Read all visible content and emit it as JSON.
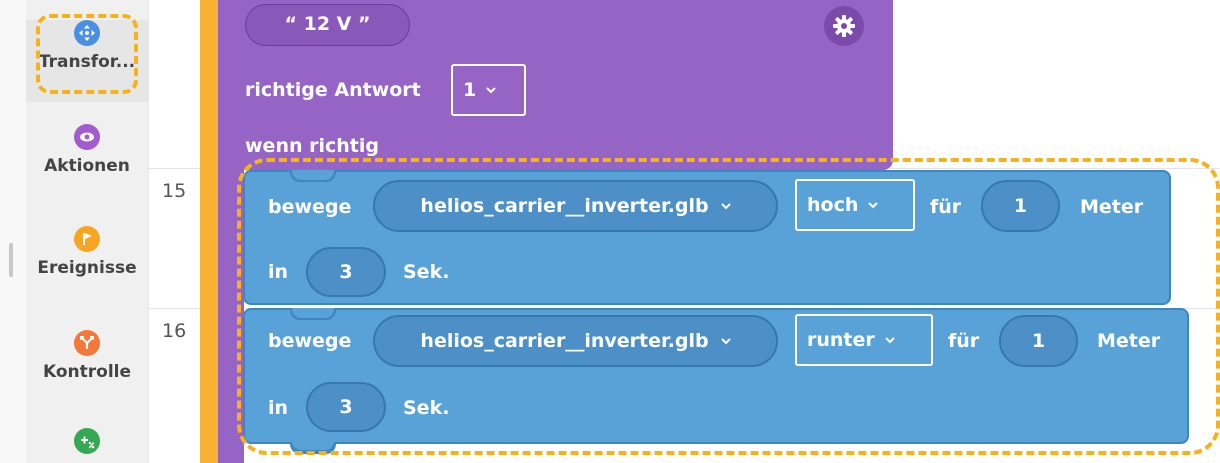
{
  "sidebar": {
    "categories": [
      {
        "label": "Transfor...",
        "icon": "move-arrows-icon",
        "color": "#4a90e2",
        "active": true
      },
      {
        "label": "Aktionen",
        "icon": "eye-icon",
        "color": "#a45bd0",
        "active": false
      },
      {
        "label": "Ereignisse",
        "icon": "flag-icon",
        "color": "#f6a623",
        "active": false
      },
      {
        "label": "Kontrolle",
        "icon": "branch-icon",
        "color": "#f5773a",
        "active": false
      },
      {
        "label": "",
        "icon": "math-plus-percent-icon",
        "color": "#34a853",
        "active": false
      }
    ]
  },
  "editor": {
    "line_numbers": [
      "15",
      "16"
    ],
    "purple_block": {
      "string_value": "“  12 V  ”",
      "correct_answer_label": "richtige Antwort",
      "correct_answer_value": "1",
      "if_correct_label": "wenn richtig"
    },
    "blocks": [
      {
        "verb": "bewege",
        "object": "helios_carrier__inverter.glb",
        "direction": "hoch",
        "for_label": "für",
        "amount": "1",
        "unit": "Meter",
        "in_label": "in",
        "duration": "3",
        "duration_unit": "Sek."
      },
      {
        "verb": "bewege",
        "object": "helios_carrier__inverter.glb",
        "direction": "runter",
        "for_label": "für",
        "amount": "1",
        "unit": "Meter",
        "in_label": "in",
        "duration": "3",
        "duration_unit": "Sek."
      }
    ]
  },
  "colors": {
    "highlight": "#f6b21a",
    "purple_block": "#9664c4",
    "blue_block": "#58a2d8",
    "orange_bar": "#f7b234"
  }
}
